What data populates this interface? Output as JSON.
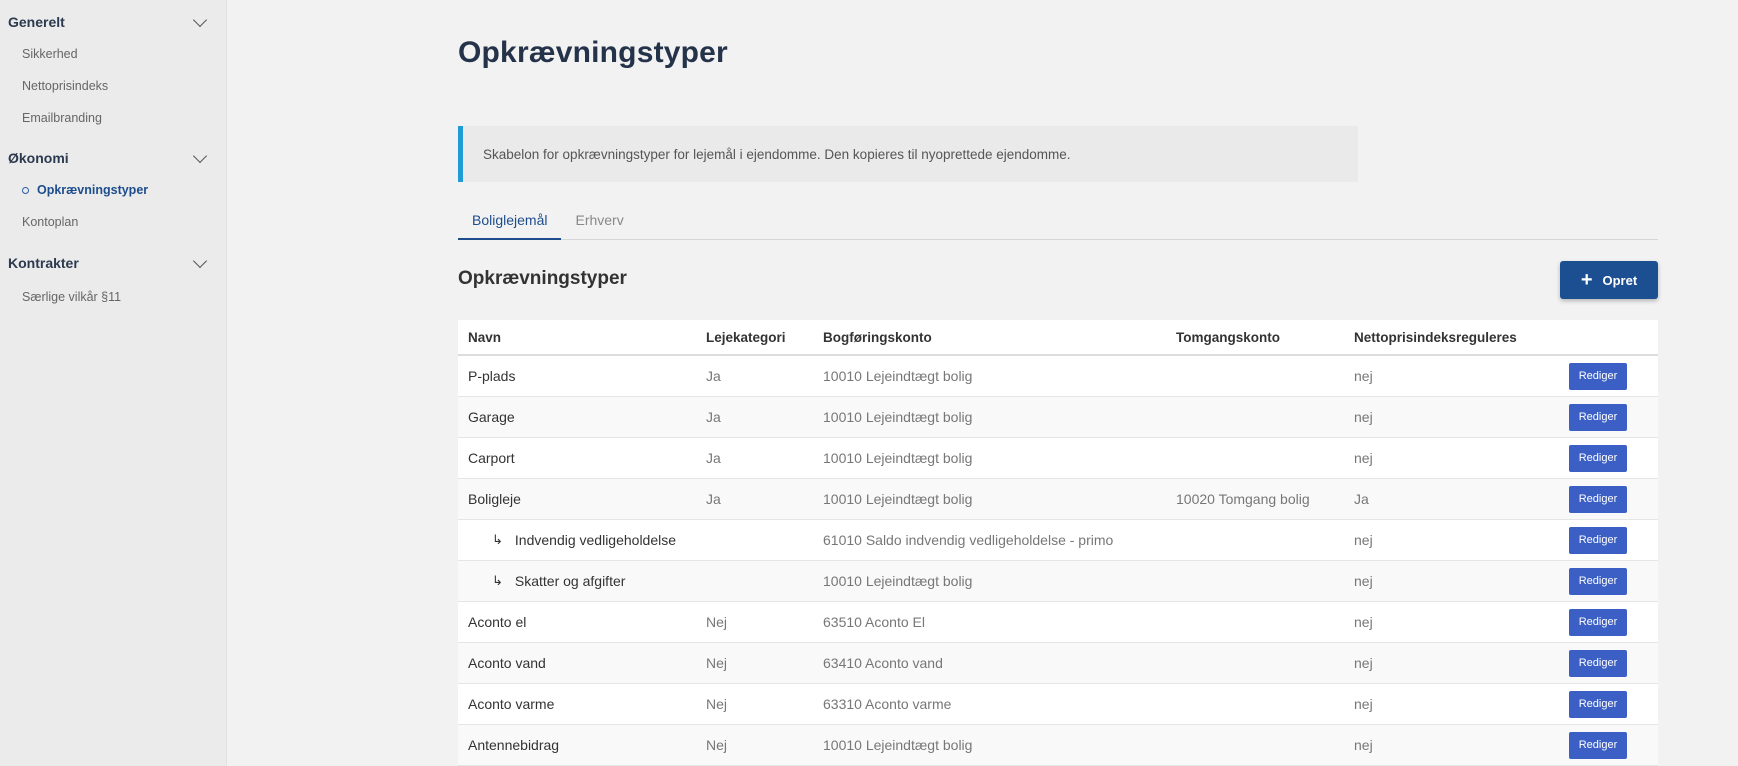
{
  "sidebar": {
    "groups": [
      {
        "title": "Generelt",
        "items": [
          "Sikkerhed",
          "Nettoprisindeks",
          "Emailbranding"
        ]
      },
      {
        "title": "Økonomi",
        "items": [
          "Opkrævningstyper",
          "Kontoplan"
        ]
      },
      {
        "title": "Kontrakter",
        "items": [
          "Særlige vilkår §11"
        ]
      }
    ],
    "active_item": "Opkrævningstyper"
  },
  "page": {
    "title": "Opkrævningstyper",
    "info": "Skabelon for opkrævningstyper for lejemål i ejendomme. Den kopieres til nyoprettede ejendomme.",
    "tabs": [
      "Boliglejemål",
      "Erhverv"
    ],
    "active_tab": "Boliglejemål",
    "section_title": "Opkrævningstyper",
    "create_button": "Opret",
    "colors": {
      "primary": "#1b4f92",
      "accent": "#1f9bd7",
      "edit_button": "#3b5fc4"
    }
  },
  "table": {
    "headers": [
      "Navn",
      "Lejekategori",
      "Bogføringskonto",
      "Tomgangskonto",
      "Nettoprisindeksreguleres"
    ],
    "edit_label": "Rediger",
    "rows": [
      {
        "name": "P-plads",
        "category": "Ja",
        "account": "10010 Lejeindtægt bolig",
        "vacancy": "",
        "npi": "nej"
      },
      {
        "name": "Garage",
        "category": "Ja",
        "account": "10010 Lejeindtægt bolig",
        "vacancy": "",
        "npi": "nej"
      },
      {
        "name": "Carport",
        "category": "Ja",
        "account": "10010 Lejeindtægt bolig",
        "vacancy": "",
        "npi": "nej"
      },
      {
        "name": "Boligleje",
        "category": "Ja",
        "account": "10010 Lejeindtægt bolig",
        "vacancy": "10020 Tomgang bolig",
        "npi": "Ja"
      },
      {
        "name": "Indvendig vedligeholdelse",
        "category": "",
        "account": "61010 Saldo indvendig vedligeholdelse - primo",
        "vacancy": "",
        "npi": "nej",
        "sub_arrow": "↳"
      },
      {
        "name": "Skatter og afgifter",
        "category": "",
        "account": "10010 Lejeindtægt bolig",
        "vacancy": "",
        "npi": "nej",
        "sub_arrow": "↳"
      },
      {
        "name": "Aconto el",
        "category": "Nej",
        "account": "63510 Aconto El",
        "vacancy": "",
        "npi": "nej"
      },
      {
        "name": "Aconto vand",
        "category": "Nej",
        "account": "63410 Aconto vand",
        "vacancy": "",
        "npi": "nej"
      },
      {
        "name": "Aconto varme",
        "category": "Nej",
        "account": "63310 Aconto varme",
        "vacancy": "",
        "npi": "nej"
      },
      {
        "name": "Antennebidrag",
        "category": "Nej",
        "account": "10010 Lejeindtægt bolig",
        "vacancy": "",
        "npi": "nej"
      }
    ]
  }
}
